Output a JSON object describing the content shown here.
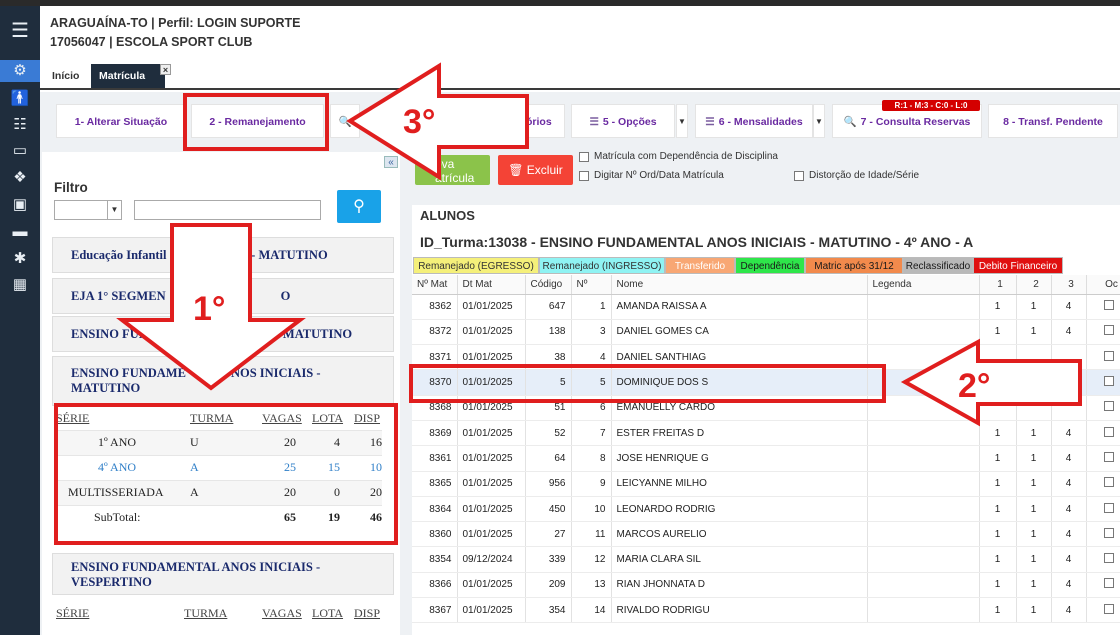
{
  "header": {
    "line1": "ARAGUAÍNA-TO | Perfil: LOGIN SUPORTE",
    "line2": "17056047 | ESCOLA SPORT CLUB"
  },
  "tabs": [
    {
      "label": "Início"
    },
    {
      "label": "Matrícula",
      "close": "×"
    }
  ],
  "sidebar_icons": [
    "menu-icon",
    "gears-icon",
    "person-icon",
    "list-icon",
    "card-icon",
    "dropbox-icon",
    "bus-icon",
    "monitor-icon",
    "gear-icon",
    "table-icon"
  ],
  "toolbar": {
    "buttons": [
      {
        "label": "1- Alterar Situação"
      },
      {
        "label": "2 - Remanejamento"
      },
      {
        "label": "órios"
      },
      {
        "label": "5 - Opções",
        "icon": "sliders-icon"
      },
      {
        "label": "6 - Mensalidades",
        "icon": "sliders-icon"
      },
      {
        "label": "7 - Consulta Reservas",
        "icon": "search-icon"
      },
      {
        "label": "8 - Transf. Pendente"
      }
    ],
    "reserva_badge": "R:1 - M:3 - C:0 - L:0"
  },
  "filter": {
    "label": "Filtro",
    "collapse": "«",
    "search_icon": "search-icon"
  },
  "groups": [
    {
      "title_left": "Educação Infantil",
      "title_right": "cola - MATUTINO"
    },
    {
      "title_left": "EJA 1° SEGMEN",
      "title_right": "O"
    },
    {
      "title_left": "ENSINO FUNDA",
      "title_right": "OS - MATUTINO"
    },
    {
      "title_left": "ENSINO FUNDAME",
      "title_right": "NOS INICIAIS -",
      "title_line2": "MATUTINO"
    },
    {
      "title": "ENSINO FUNDAMENTAL ANOS INICIAIS - VESPERTINO"
    }
  ],
  "series_table": {
    "headers": [
      "SÉRIE",
      "TURMA",
      "VAGAS",
      "LOTA",
      "DISP"
    ],
    "rows": [
      {
        "serie": "1º ANO",
        "turma": "U",
        "vagas": "20",
        "lota": "4",
        "disp": "16"
      },
      {
        "serie": "4º ANO",
        "turma": "A",
        "vagas": "25",
        "lota": "15",
        "disp": "10"
      },
      {
        "serie": "MULTISSERIADA",
        "turma": "A",
        "vagas": "20",
        "lota": "0",
        "disp": "20"
      }
    ],
    "subtotal": {
      "label": "SubTotal:",
      "vagas": "65",
      "lota": "19",
      "disp": "46"
    }
  },
  "series_table2": {
    "headers": [
      "SÉRIE",
      "TURMA",
      "VAGAS",
      "LOTA",
      "DISP"
    ]
  },
  "actions": {
    "nova_line1": "ova",
    "nova_line2": "atrícula",
    "excluir": "Excluir",
    "checks": [
      {
        "label": "Matrícula com Dependência de Disciplina"
      },
      {
        "label": "Digitar Nº Ord/Data Matrícula"
      },
      {
        "label": "Distorção de Idade/Série"
      }
    ]
  },
  "alunos": {
    "title": "ALUNOS",
    "turma_title": "ID_Turma:13038 - ENSINO FUNDAMENTAL ANOS INICIAIS - MATUTINO - 4º ANO - A",
    "legend": [
      {
        "label": "Remanejado (EGRESSO)",
        "bg": "#f5f07a",
        "fg": "#333333"
      },
      {
        "label": "Remanejado (INGRESSO)",
        "bg": "#8ff3f3",
        "fg": "#333333"
      },
      {
        "label": "Transferido",
        "bg": "#f8a774",
        "fg": "#ffffff"
      },
      {
        "label": "Dependência",
        "bg": "#2ee64a",
        "fg": "#1a1a1a"
      },
      {
        "label": "Matric após 31/12",
        "bg": "#f28a4c",
        "fg": "#1a1a1a"
      },
      {
        "label": "Reclassificado",
        "bg": "#b9b9b9",
        "fg": "#1a1a1a"
      },
      {
        "label": "Debito Financeiro",
        "bg": "#e01010",
        "fg": "#ffffff"
      }
    ],
    "columns": [
      "Nº Mat",
      "Dt Mat",
      "Código",
      "Nº",
      "Nome",
      "Legenda",
      "1",
      "2",
      "3",
      "Oc"
    ],
    "rows": [
      {
        "mat": "8362",
        "dt": "01/01/2025",
        "cod": "647",
        "n": "1",
        "nome": "AMANDA RAISSA A",
        "c1": "1",
        "c2": "1",
        "c3": "4"
      },
      {
        "mat": "8372",
        "dt": "01/01/2025",
        "cod": "138",
        "n": "3",
        "nome": "DANIEL GOMES CA",
        "c1": "1",
        "c2": "1",
        "c3": "4"
      },
      {
        "mat": "8371",
        "dt": "01/01/2025",
        "cod": "38",
        "n": "4",
        "nome": "DANIEL SANTHIAG",
        "c1": "",
        "c2": "",
        "c3": ""
      },
      {
        "mat": "8370",
        "dt": "01/01/2025",
        "cod": "5",
        "n": "5",
        "nome": "DOMINIQUE DOS S",
        "c1": "",
        "c2": "",
        "c3": "",
        "selected": true
      },
      {
        "mat": "8368",
        "dt": "01/01/2025",
        "cod": "51",
        "n": "6",
        "nome": "EMANUELLY CARDO",
        "c1": "",
        "c2": "",
        "c3": ""
      },
      {
        "mat": "8369",
        "dt": "01/01/2025",
        "cod": "52",
        "n": "7",
        "nome": "ESTER FREITAS D",
        "c1": "1",
        "c2": "1",
        "c3": "4"
      },
      {
        "mat": "8361",
        "dt": "01/01/2025",
        "cod": "64",
        "n": "8",
        "nome": "JOSE HENRIQUE G",
        "c1": "1",
        "c2": "1",
        "c3": "4"
      },
      {
        "mat": "8365",
        "dt": "01/01/2025",
        "cod": "956",
        "n": "9",
        "nome": "LEICYANNE MILHO",
        "c1": "1",
        "c2": "1",
        "c3": "4"
      },
      {
        "mat": "8364",
        "dt": "01/01/2025",
        "cod": "450",
        "n": "10",
        "nome": "LEONARDO RODRIG",
        "c1": "1",
        "c2": "1",
        "c3": "4"
      },
      {
        "mat": "8360",
        "dt": "01/01/2025",
        "cod": "27",
        "n": "11",
        "nome": "MARCOS AURELIO",
        "c1": "1",
        "c2": "1",
        "c3": "4"
      },
      {
        "mat": "8354",
        "dt": "09/12/2024",
        "cod": "339",
        "n": "12",
        "nome": "MARIA CLARA SIL",
        "c1": "1",
        "c2": "1",
        "c3": "4"
      },
      {
        "mat": "8366",
        "dt": "01/01/2025",
        "cod": "209",
        "n": "13",
        "nome": "RIAN JHONNATA D",
        "c1": "1",
        "c2": "1",
        "c3": "4"
      },
      {
        "mat": "8367",
        "dt": "01/01/2025",
        "cod": "354",
        "n": "14",
        "nome": "RIVALDO RODRIGU",
        "c1": "1",
        "c2": "1",
        "c3": "4"
      }
    ]
  },
  "annotations": [
    {
      "label": "1°"
    },
    {
      "label": "2°"
    },
    {
      "label": "3°"
    }
  ]
}
